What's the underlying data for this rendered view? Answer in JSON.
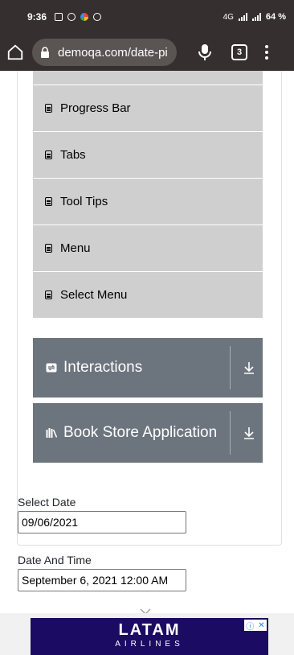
{
  "status_bar": {
    "time": "9:36",
    "network": "4G",
    "battery": "64 %"
  },
  "browser": {
    "url": "demoqa.com/date-pi",
    "tab_count": "3"
  },
  "sidebar": {
    "items": [
      {
        "label": "Progress Bar"
      },
      {
        "label": "Tabs"
      },
      {
        "label": "Tool Tips"
      },
      {
        "label": "Menu"
      },
      {
        "label": "Select Menu"
      }
    ],
    "groups": [
      {
        "label": "Interactions"
      },
      {
        "label": "Book Store Application"
      }
    ]
  },
  "form": {
    "select_date_label": "Select Date",
    "select_date_value": "09/06/2021",
    "date_time_label": "Date And Time",
    "date_time_value": "September 6, 2021 12:00 AM"
  },
  "ad": {
    "brand": "LATAM",
    "tagline": "AIRLINES"
  },
  "colors": {
    "topbar": "#35302f",
    "group_bg": "#6c757d",
    "item_bg": "#cfcfcf",
    "ad_bg": "#1b0b62"
  }
}
